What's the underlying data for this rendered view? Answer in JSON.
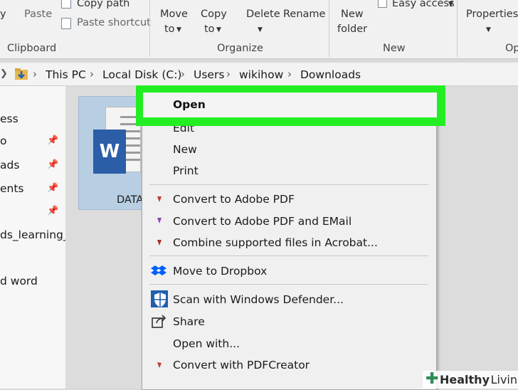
{
  "ribbon": {
    "clipboard": {
      "label": "Clipboard",
      "copy_partial": "y",
      "paste": "Paste",
      "copy_path": "Copy path",
      "paste_shortcut": "Paste shortcut"
    },
    "organize": {
      "label": "Organize",
      "move_to_1": "Move",
      "move_to_2": "to",
      "copy_to_1": "Copy",
      "copy_to_2": "to",
      "delete": "Delete",
      "rename": "Rename"
    },
    "new": {
      "label": "New",
      "new_folder_1": "New",
      "new_folder_2": "folder",
      "easy_access": "Easy access"
    },
    "open": {
      "label_partial": "Op",
      "properties": "Properties"
    }
  },
  "breadcrumb": [
    "This PC",
    "Local Disk (C:)",
    "Users",
    "wikihow",
    "Downloads"
  ],
  "nav": {
    "items": [
      "ess",
      "o",
      "ads",
      "ents",
      "",
      "ds_learning_p",
      "d word"
    ]
  },
  "file": {
    "label": "DATA"
  },
  "menu": {
    "items": {
      "open": "Open",
      "edit": "Edit",
      "new": "New",
      "print": "Print",
      "convert_pdf": "Convert to Adobe PDF",
      "convert_pdf_email": "Convert to Adobe PDF and EMail",
      "combine": "Combine supported files in Acrobat...",
      "dropbox": "Move to Dropbox",
      "defender": "Scan with Windows Defender...",
      "share": "Share",
      "open_with": "Open with...",
      "pdfcreator": "Convert with PDFCreator"
    }
  },
  "watermark": {
    "brand_bold": "Healthy",
    "brand_light": "Living"
  },
  "colors": {
    "highlight": "#22ee22",
    "word_blue": "#2c5ea8",
    "dropbox_blue": "#0061fe",
    "defender_blue": "#1f5fae"
  }
}
